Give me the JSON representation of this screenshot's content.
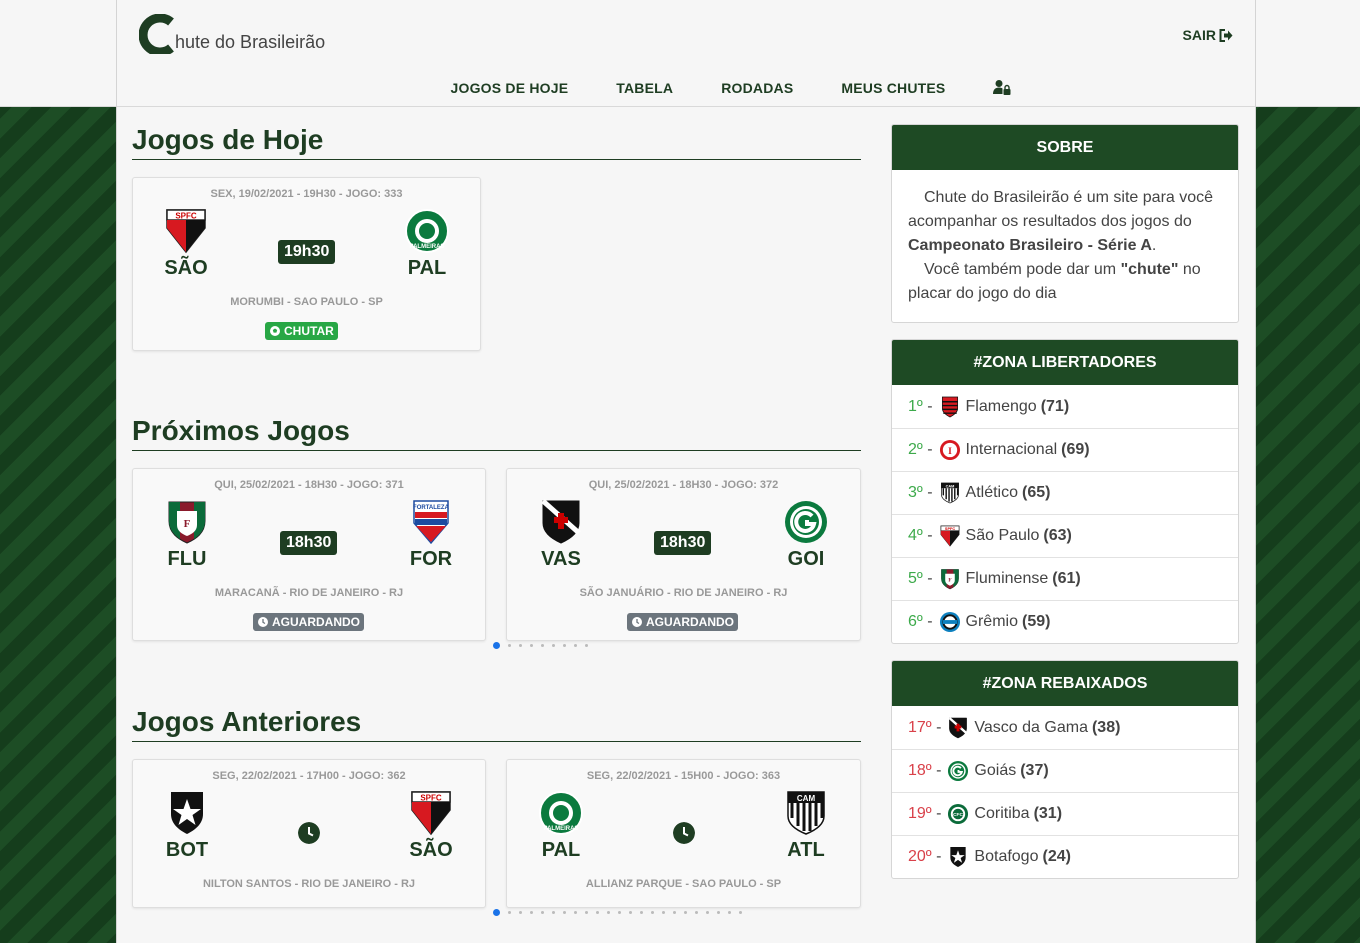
{
  "header": {
    "logo_letter": "C",
    "logo_text": "hute do Brasileirão",
    "logout_label": "SAIR",
    "nav": [
      "JOGOS DE HOJE",
      "TABELA",
      "RODADAS",
      "MEUS CHUTES"
    ],
    "nav_icon": "user-lock-icon"
  },
  "today": {
    "title": "Jogos de Hoje",
    "games": [
      {
        "meta": "SEX, 19/02/2021 - 19H30 - JOGO: 333",
        "home": "SÃO",
        "away": "PAL",
        "time": "19h30",
        "venue": "MORUMBI - SAO PAULO - SP",
        "action": "CHUTAR",
        "action_icon": "soccer-ball-icon",
        "action_color": "#28a745"
      }
    ]
  },
  "next": {
    "title": "Próximos Jogos",
    "games": [
      {
        "meta": "QUI, 25/02/2021 - 18H30 - JOGO: 371",
        "home": "FLU",
        "away": "FOR",
        "time": "18h30",
        "venue": "MARACANÃ - RIO DE JANEIRO - RJ",
        "action": "AGUARDANDO",
        "action_icon": "clock-icon",
        "action_color": "#6c757d"
      },
      {
        "meta": "QUI, 25/02/2021 - 18H30 - JOGO: 372",
        "home": "VAS",
        "away": "GOI",
        "time": "18h30",
        "venue": "SÃO JANUÁRIO - RIO DE JANEIRO - RJ",
        "action": "AGUARDANDO",
        "action_icon": "clock-icon",
        "action_color": "#6c757d"
      }
    ],
    "dots": 9
  },
  "previous": {
    "title": "Jogos Anteriores",
    "games": [
      {
        "meta": "SEG, 22/02/2021 - 17H00 - JOGO: 362",
        "home": "BOT",
        "away": "SÃO",
        "venue": "NILTON SANTOS - RIO DE JANEIRO - RJ"
      },
      {
        "meta": "SEG, 22/02/2021 - 15H00 - JOGO: 363",
        "home": "PAL",
        "away": "ATL",
        "venue": "ALLIANZ PARQUE - SAO PAULO - SP"
      }
    ],
    "dots": 23
  },
  "about": {
    "title": "SOBRE",
    "p1_pre": "Chute do Brasileirão é um site para você acompanhar os resultados dos jogos do ",
    "p1_bold": "Campeonato Brasileiro - Série A",
    "p1_post": ".",
    "p2_pre": "Você também pode dar um ",
    "p2_bold": "\"chute\"",
    "p2_post": " no placar do jogo do dia"
  },
  "libertadores": {
    "title": "#ZONA LIBERTADORES",
    "rows": [
      {
        "pos": "1º",
        "team": "Flamengo",
        "pts": "(71)"
      },
      {
        "pos": "2º",
        "team": "Internacional",
        "pts": "(69)"
      },
      {
        "pos": "3º",
        "team": "Atlético",
        "pts": "(65)"
      },
      {
        "pos": "4º",
        "team": "São Paulo",
        "pts": "(63)"
      },
      {
        "pos": "5º",
        "team": "Fluminense",
        "pts": "(61)"
      },
      {
        "pos": "6º",
        "team": "Grêmio",
        "pts": "(59)"
      }
    ]
  },
  "rebaixados": {
    "title": "#ZONA REBAIXADOS",
    "rows": [
      {
        "pos": "17º",
        "team": "Vasco da Gama",
        "pts": "(38)"
      },
      {
        "pos": "18º",
        "team": "Goiás",
        "pts": "(37)"
      },
      {
        "pos": "19º",
        "team": "Coritiba",
        "pts": "(31)"
      },
      {
        "pos": "20º",
        "team": "Botafogo",
        "pts": "(24)"
      }
    ]
  },
  "colors": {
    "brand": "#1e3d22",
    "accent_green": "#3daa4b",
    "danger": "#d9414a",
    "carousel_active": "#1a73e8"
  }
}
